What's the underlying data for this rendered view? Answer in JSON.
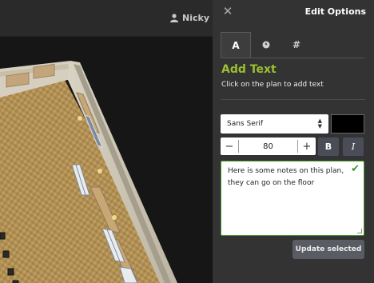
{
  "topbar": {
    "user_name": "Nicky"
  },
  "panel": {
    "title": "Edit Options",
    "tabs": [
      {
        "label": "A",
        "icon": "text-icon",
        "active": true
      },
      {
        "label": "",
        "icon": "compass-icon",
        "active": false
      },
      {
        "label": "#",
        "icon": "hash-icon",
        "active": false
      }
    ],
    "section_title": "Add Text",
    "section_subtitle": "Click on the plan to add text",
    "font": {
      "selected": "Sans Serif"
    },
    "color": "#000000",
    "size": {
      "value": "80",
      "minus": "−",
      "plus": "+"
    },
    "bold_label": "B",
    "italic_label": "I",
    "note_text": "Here is some notes on this plan, they can go on the floor",
    "update_button": "Update selected"
  },
  "colors": {
    "accent": "#9bbf2f",
    "panel_bg": "#333333",
    "check": "#3d9a2b"
  }
}
